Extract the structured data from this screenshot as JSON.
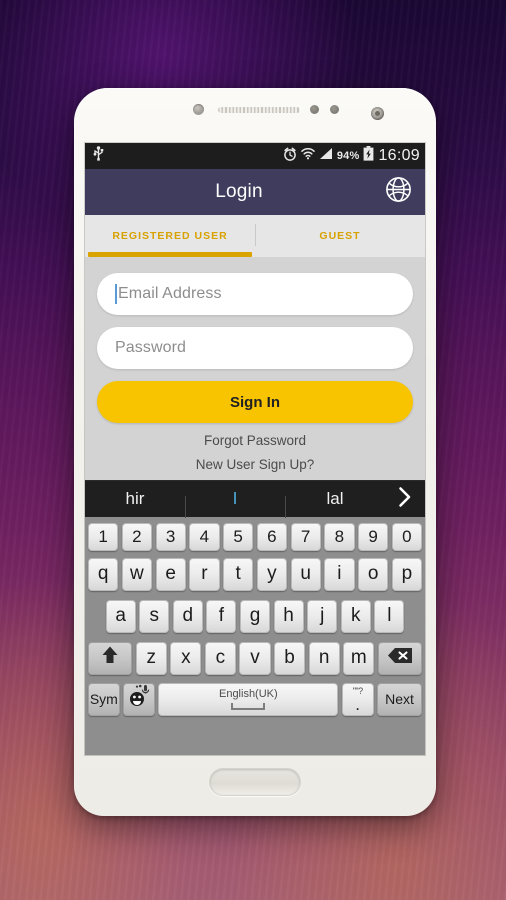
{
  "statusbar": {
    "usb_icon": "usb-icon",
    "alarm_icon": "alarm-clock-icon",
    "wifi_icon": "wifi-icon",
    "signal_icon": "cellular-signal-icon",
    "battery_percent": "94%",
    "battery_icon": "battery-charging-icon",
    "clock": "16:09"
  },
  "appbar": {
    "title": "Login",
    "globe_icon": "globe-icon",
    "bg_color": "#3f3c5e"
  },
  "tabs": {
    "items": [
      {
        "label": "REGISTERED USER",
        "active": true
      },
      {
        "label": "GUEST",
        "active": false
      }
    ],
    "accent_color": "#d9a400"
  },
  "form": {
    "email": {
      "value": "",
      "placeholder": "Email Address",
      "focused": true
    },
    "password": {
      "value": "",
      "placeholder": "Password",
      "focused": false
    },
    "signin_label": "Sign In",
    "signin_color": "#f8c400",
    "forgot_label": "Forgot Password",
    "signup_label": "New User Sign Up?"
  },
  "keyboard": {
    "suggestions": [
      {
        "text": "hir",
        "active": false
      },
      {
        "text": "l",
        "active": true
      },
      {
        "text": "lal",
        "active": false
      }
    ],
    "expand_icon": "chevron-right-icon",
    "number_row": [
      "1",
      "2",
      "3",
      "4",
      "5",
      "6",
      "7",
      "8",
      "9",
      "0"
    ],
    "row1": [
      "q",
      "w",
      "e",
      "r",
      "t",
      "y",
      "u",
      "i",
      "o",
      "p"
    ],
    "row2": [
      "a",
      "s",
      "d",
      "f",
      "g",
      "h",
      "j",
      "k",
      "l"
    ],
    "row3": [
      "z",
      "x",
      "c",
      "v",
      "b",
      "n",
      "m"
    ],
    "shift_icon": "shift-arrow-icon",
    "backspace_icon": "backspace-icon",
    "sym_label": "Sym",
    "emoji_icon": "emoji-mic-icon",
    "space_label": "English(UK)",
    "punct_top_label": "\"\"?",
    "punct_main_label": ".",
    "next_label": "Next"
  },
  "phone": {
    "sensor_icon": "proximity-sensor",
    "earpiece_icon": "earpiece-speaker",
    "camera_icon": "front-camera",
    "home_button": "home-button"
  }
}
